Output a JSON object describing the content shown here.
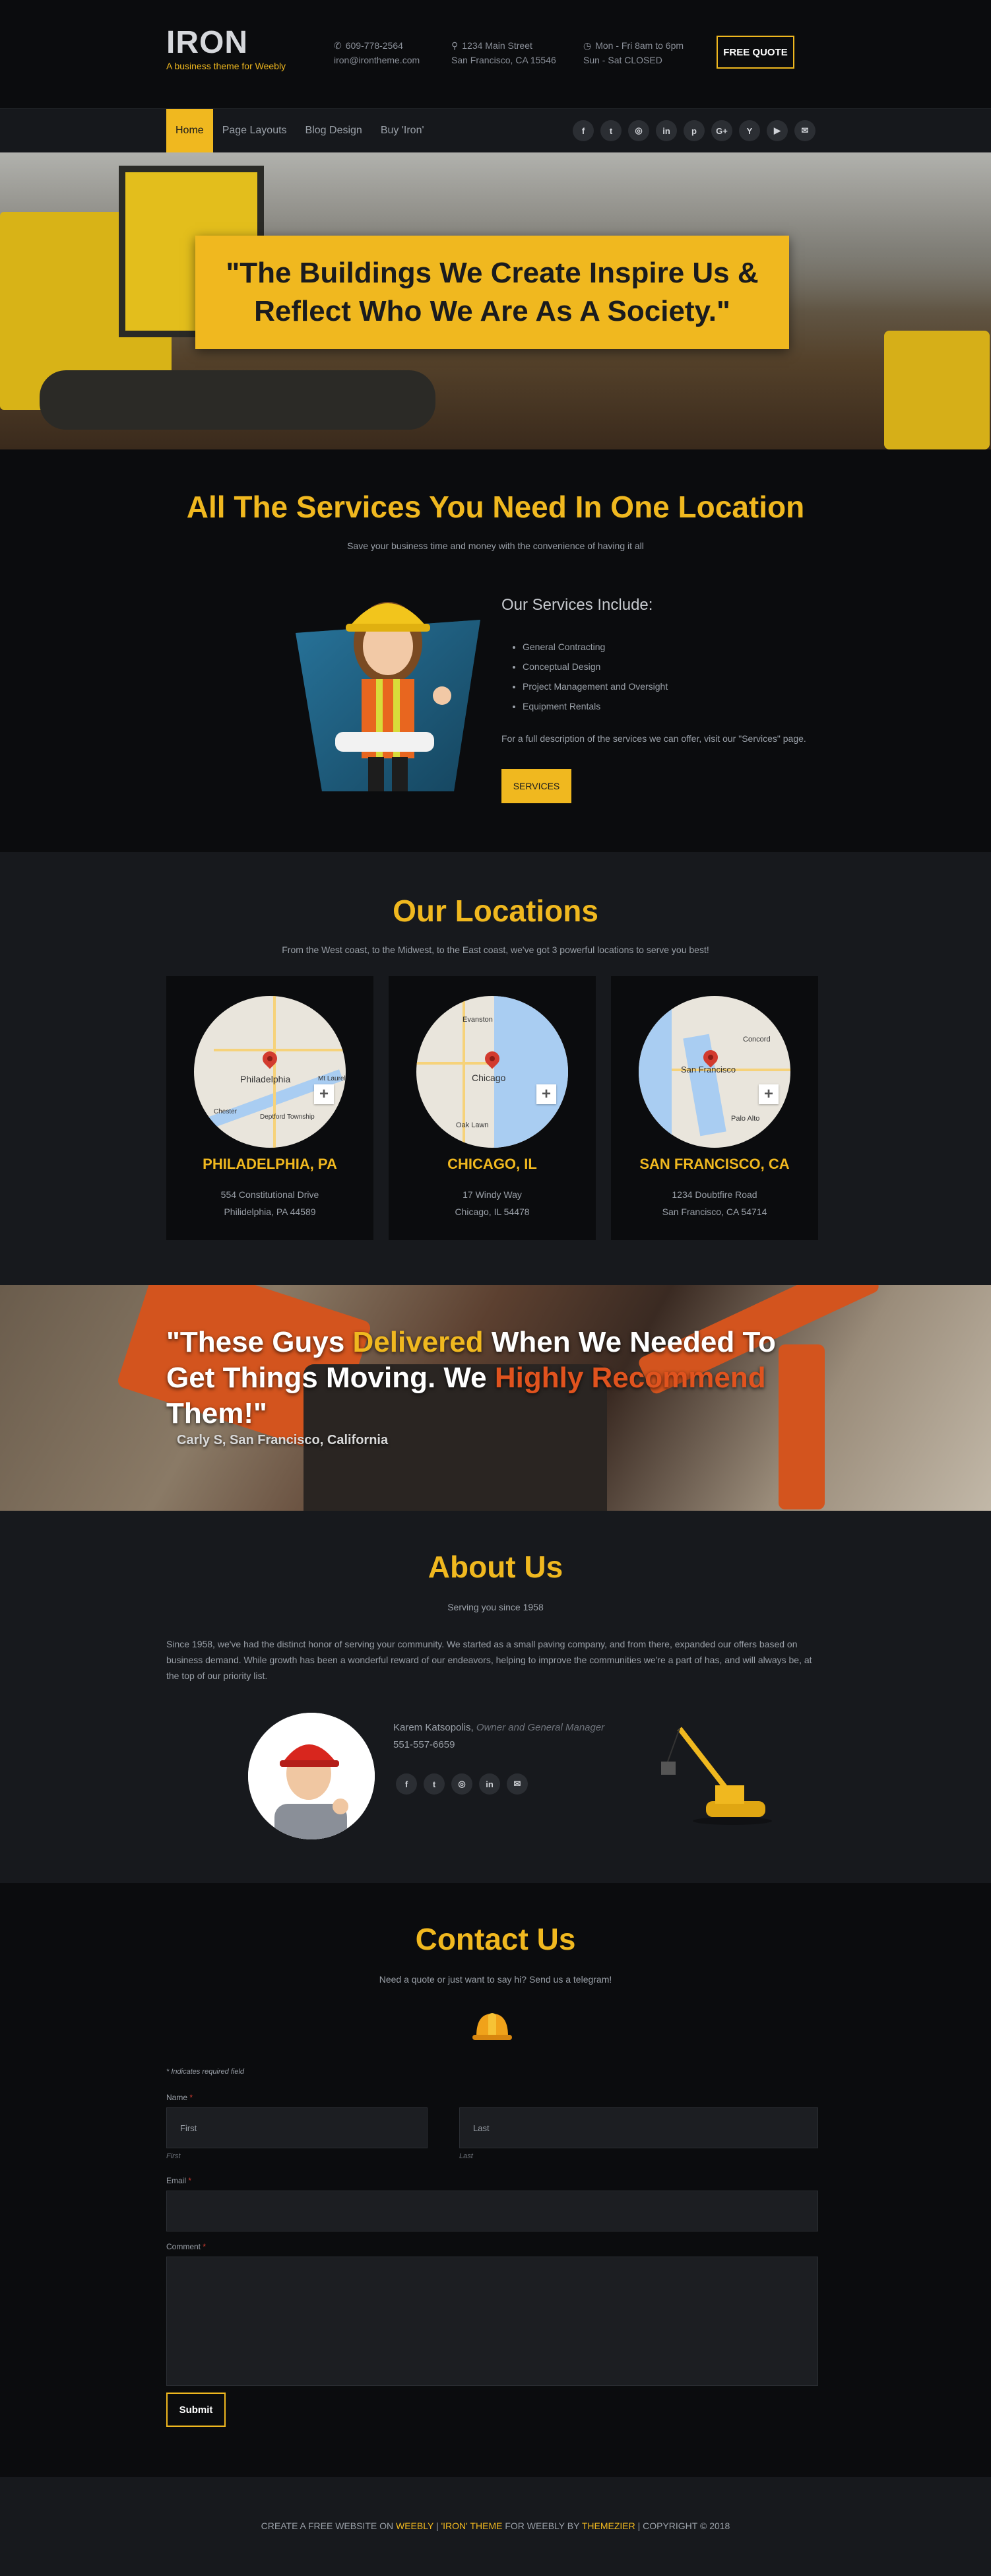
{
  "header": {
    "logo_name": "IRON",
    "logo_tagline": "A business theme for Weebly",
    "phone": "609-778-2564",
    "email": "iron@irontheme.com",
    "address_line1": "1234 Main Street",
    "address_line2": "San Francisco, CA 15546",
    "hours_line1": "Mon - Fri 8am to 6pm",
    "hours_line2": "Sun - Sat CLOSED",
    "quote_button": "FREE QUOTE"
  },
  "nav": {
    "items": [
      {
        "label": "Home",
        "active": true
      },
      {
        "label": "Page Layouts",
        "active": false
      },
      {
        "label": "Blog Design",
        "active": false
      },
      {
        "label": "Buy 'Iron'",
        "active": false
      }
    ],
    "socials": [
      "f",
      "t",
      "ig",
      "in",
      "p",
      "G+",
      "Y",
      "yt",
      "mail"
    ]
  },
  "hero": {
    "headline": "\"The Buildings We Create Inspire Us & Reflect Who We Are As A Society.\""
  },
  "services": {
    "title": "All The Services You Need In One Location",
    "subtitle": "Save your business time and money with the convenience of having it all",
    "heading": "Our Services Include:",
    "items": [
      "General Contracting",
      "Conceptual Design",
      "Project Management and Oversight",
      "Equipment Rentals"
    ],
    "note": "For a full description of the services we can offer, visit our \"Services\" page.",
    "button": "SERVICES"
  },
  "locations": {
    "title": "Our Locations",
    "subtitle": "From the West coast, to the Midwest, to the East coast, we've got 3 powerful locations to serve you best!",
    "cards": [
      {
        "city": "PHILADELPHIA, PA",
        "street": "554 Constitutional Drive",
        "citystate": "Philidelphia, PA 44589",
        "map_labels": [
          "Philadelphia",
          "Mt Laurel",
          "Chester",
          "Deptford Township"
        ]
      },
      {
        "city": "CHICAGO, IL",
        "street": "17 Windy Way",
        "citystate": "Chicago, IL 54478",
        "map_labels": [
          "Evanston",
          "Chicago",
          "Oak Lawn"
        ]
      },
      {
        "city": "SAN FRANCISCO, CA",
        "street": "1234 Doubtfire Road",
        "citystate": "San Francisco, CA 54714",
        "map_labels": [
          "San Francisco",
          "Concord",
          "Palo Alto"
        ]
      }
    ]
  },
  "testimonial": {
    "quote_part1": "\"These Guys ",
    "quote_hl1": "Delivered",
    "quote_part2": " When We Needed To Get Things Moving. We ",
    "quote_hl2": "Highly Recommend",
    "quote_part3": " Them!\"",
    "author": "Carly S, San Francisco, California"
  },
  "about": {
    "title": "About Us",
    "subtitle": "Serving you since 1958",
    "text": "Since 1958, we've had the distinct honor of serving your community. We started as a small paving company, and from there, expanded our offers based on business demand. While growth has been a wonderful reward of our endeavors, helping to improve the communities we're a part of has, and will always be, at the top of our priority list.",
    "person_name": "Karem Katsopolis,",
    "person_role": "Owner and General Manager",
    "person_phone": "551-557-6659",
    "person_socials": [
      "f",
      "t",
      "ig",
      "in",
      "mail"
    ]
  },
  "contact": {
    "title": "Contact Us",
    "subtitle": "Need a quote or just want to say hi? Send us a telegram!",
    "required_note": "* Indicates required field",
    "name_label": "Name",
    "first_placeholder": "First",
    "last_placeholder": "Last",
    "first_sub": "First",
    "last_sub": "Last",
    "email_label": "Email",
    "comment_label": "Comment",
    "submit": "Submit"
  },
  "footer": {
    "part1": "CREATE A FREE WEBSITE ON ",
    "link1": "WEEBLY",
    "sep1": " | ",
    "link2": "'IRON' THEME",
    "part2": " FOR WEEBLY BY ",
    "link3": "THEMEZIER",
    "part3": " | COPYRIGHT © 2018"
  },
  "colors": {
    "accent": "#f0b81f",
    "background": "#0b0c0e",
    "panel": "#17191d",
    "orange": "#e0531e"
  }
}
